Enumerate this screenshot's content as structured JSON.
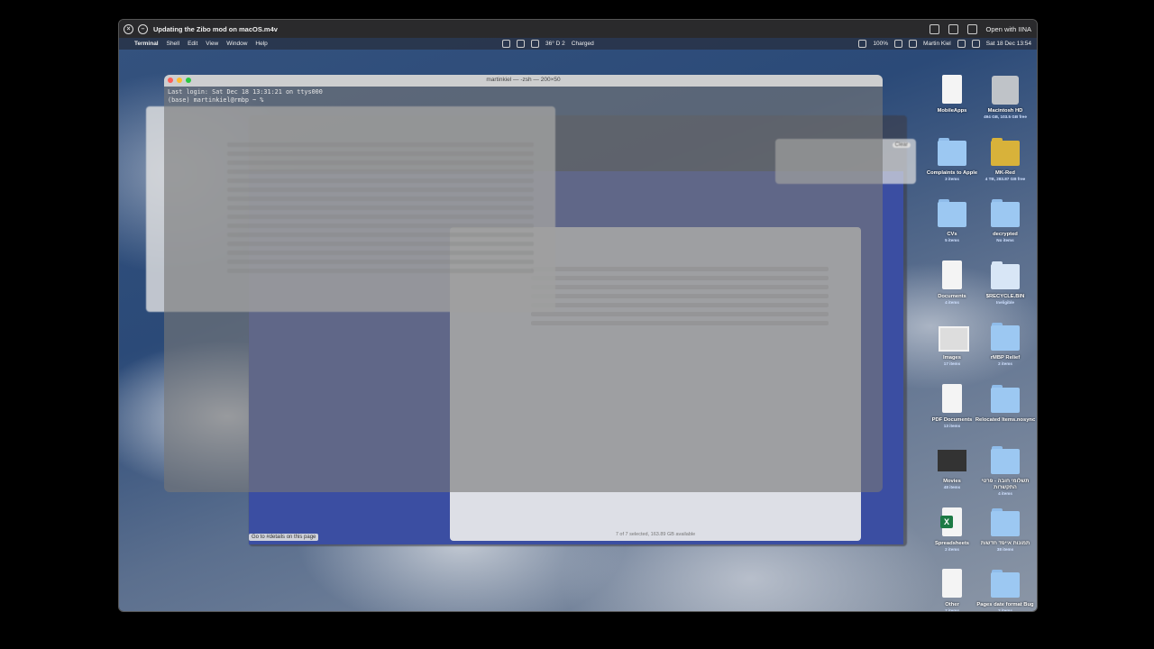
{
  "player": {
    "title": "Updating the Zibo mod on macOS.m4v",
    "open_with": "Open with IINA"
  },
  "menubar": {
    "app": "Terminal",
    "items": [
      "Shell",
      "Edit",
      "View",
      "Window",
      "Help"
    ],
    "weather": "36° D 2",
    "battery_status": "Charged",
    "battery_percent": "100%",
    "user": "Martin Kiel",
    "datetime": "Sat 18 Dec  13:54"
  },
  "terminal": {
    "title": "martinkiel — -zsh — 200×50",
    "line1": "Last login: Sat Dec 18 13:31:21 on ttys000",
    "line2": "(base) martinkiel@rmbp ~ %"
  },
  "browser": {
    "link_hint": "Go to #details on this page"
  },
  "finder": {
    "status": "7 of 7 selected, 163.89 GB available",
    "clear_label": "Clear"
  },
  "desktop_icons": [
    {
      "label": "MobileApps",
      "sub": "",
      "kind": "doc"
    },
    {
      "label": "Macintosh HD",
      "sub": "494 GB, 103.5 GB free",
      "kind": "hdd"
    },
    {
      "label": "Complaints to Apple",
      "sub": "3 items",
      "kind": "folder"
    },
    {
      "label": "MK-Red",
      "sub": "4 TB, 283.87 GB free",
      "kind": "yellow"
    },
    {
      "label": "CVs",
      "sub": "5 items",
      "kind": "folder"
    },
    {
      "label": "decrypted",
      "sub": "No items",
      "kind": "folder"
    },
    {
      "label": "Documents",
      "sub": "4 items",
      "kind": "doc"
    },
    {
      "label": "$RECYCLE.BIN",
      "sub": "Ineligible",
      "kind": "light"
    },
    {
      "label": "Images",
      "sub": "17 items",
      "kind": "img"
    },
    {
      "label": "rMBP Relief",
      "sub": "2 items",
      "kind": "folder"
    },
    {
      "label": "PDF Documents",
      "sub": "13 items",
      "kind": "doc"
    },
    {
      "label": "Relocated Items.nosync",
      "sub": "",
      "kind": "folder"
    },
    {
      "label": "Movies",
      "sub": "48 items",
      "kind": "mov"
    },
    {
      "label": "תשלומי חובה - פרטי התקשרות",
      "sub": "4 items",
      "kind": "folder"
    },
    {
      "label": "Spreadsheets",
      "sub": "2 items",
      "kind": "xls"
    },
    {
      "label": "תמונות אייפד חדשות",
      "sub": "38 items",
      "kind": "folder"
    },
    {
      "label": "Other",
      "sub": "7 items",
      "kind": "doc"
    },
    {
      "label": "Pages date format Bug",
      "sub": "2 items",
      "kind": "folder"
    }
  ],
  "colors": {
    "desktop": "#2b4a78",
    "blue_page": "#3b4ea2",
    "terminal_text": "#e6e6e6"
  }
}
